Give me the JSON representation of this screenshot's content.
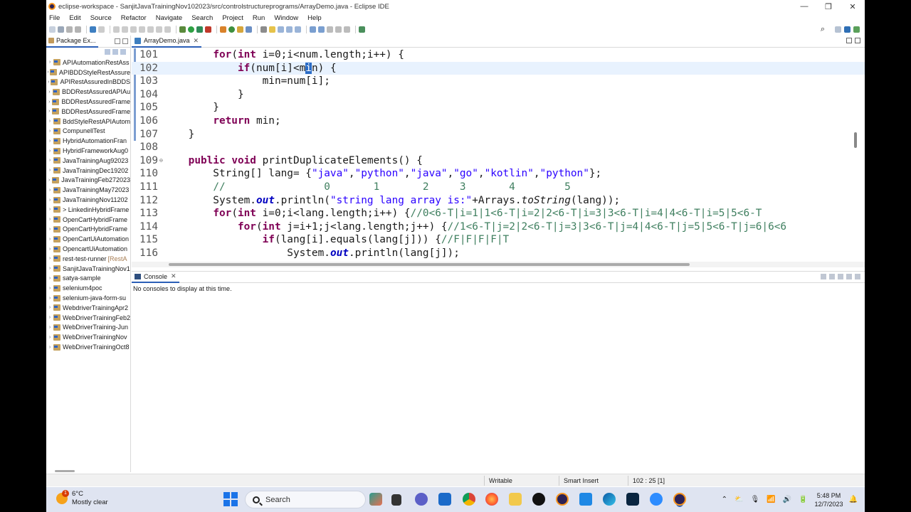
{
  "window": {
    "title": "eclipse-workspace - SanjitJavaTrainingNov102023/src/controlstructureprograms/ArrayDemo.java - Eclipse IDE"
  },
  "menu": [
    "File",
    "Edit",
    "Source",
    "Refactor",
    "Navigate",
    "Search",
    "Project",
    "Run",
    "Window",
    "Help"
  ],
  "package_explorer": {
    "tab_label": "Package Ex...",
    "projects": [
      {
        "name": "APIAutomationRestAss",
        "badge": ""
      },
      {
        "name": "APIBDDStyleRestAssure",
        "badge": ""
      },
      {
        "name": "APIRestAssuredInBDDS",
        "badge": ""
      },
      {
        "name": "BDDRestAssuredAPIAu",
        "badge": ""
      },
      {
        "name": "BDDRestAssuredFrame",
        "badge": ""
      },
      {
        "name": "BDDRestAssuredFrame",
        "badge": ""
      },
      {
        "name": "BddStyleRestAPIAutom",
        "badge": ""
      },
      {
        "name": "CompunellTest",
        "badge": ""
      },
      {
        "name": "HybridAutomationFran",
        "badge": ""
      },
      {
        "name": "HybridFrameworkAug0",
        "badge": ""
      },
      {
        "name": "JavaTrainingAug92023",
        "badge": ""
      },
      {
        "name": "JavaTrainingDec19202",
        "badge": ""
      },
      {
        "name": "JavaTrainingFeb272023",
        "badge": ""
      },
      {
        "name": "JavaTrainingMay72023",
        "badge": ""
      },
      {
        "name": "JavaTrainingNov11202",
        "badge": ""
      },
      {
        "name": "> LinkedinHybridFrame",
        "badge": ""
      },
      {
        "name": "OpenCartHybridFrame",
        "badge": ""
      },
      {
        "name": "OpenCartHybridFrame",
        "badge": ""
      },
      {
        "name": "OpenCartUiAutomation",
        "badge": ""
      },
      {
        "name": "OpencartUiAutomation",
        "badge": ""
      },
      {
        "name": "rest-test-runner",
        "badge": "[RestA"
      },
      {
        "name": "SanjitJavaTrainingNov1",
        "badge": ""
      },
      {
        "name": "satya-sample",
        "badge": ""
      },
      {
        "name": "selenium4poc",
        "badge": ""
      },
      {
        "name": "selenium-java-form-su",
        "badge": ""
      },
      {
        "name": "WebdriverTrainingApr2",
        "badge": ""
      },
      {
        "name": "WebDriverTrainingFeb2",
        "badge": ""
      },
      {
        "name": "WebDriverTraining-Jun",
        "badge": ""
      },
      {
        "name": "WebDriverTrainingNov",
        "badge": ""
      },
      {
        "name": "WebDriverTrainingOct8",
        "badge": ""
      }
    ]
  },
  "editor": {
    "tab_label": "ArrayDemo.java",
    "current_line": 102,
    "lines": [
      {
        "n": "101",
        "fold": "",
        "html": "        <span class='kw'>for</span>(<span class='kw'>int</span> i=0;i&lt;num.length;i++) {"
      },
      {
        "n": "102",
        "fold": "",
        "html": "            <span class='kw'>if</span>(num[i]&lt;m<span class='sel'>i</span>n) {"
      },
      {
        "n": "103",
        "fold": "",
        "html": "                min=num[i];"
      },
      {
        "n": "104",
        "fold": "",
        "html": "            }"
      },
      {
        "n": "105",
        "fold": "",
        "html": "        }"
      },
      {
        "n": "106",
        "fold": "",
        "html": "        <span class='kw'>return</span> min;"
      },
      {
        "n": "107",
        "fold": "",
        "html": "    }"
      },
      {
        "n": "108",
        "fold": "",
        "html": ""
      },
      {
        "n": "109",
        "fold": "⊖",
        "html": "    <span class='kw'>public</span> <span class='kw'>void</span> printDuplicateElements() {"
      },
      {
        "n": "110",
        "fold": "",
        "html": "        String[] lang= {<span class='str'>\"java\"</span>,<span class='str'>\"python\"</span>,<span class='str'>\"java\"</span>,<span class='str'>\"go\"</span>,<span class='str'>\"kotlin\"</span>,<span class='str'>\"python\"</span>};"
      },
      {
        "n": "111",
        "fold": "",
        "html": "        <span class='cm'>//                0       1       2     3       4        5</span>"
      },
      {
        "n": "112",
        "fold": "",
        "html": "        System.<span class='fld'>out</span>.println(<span class='str'>\"string lang array is:\"</span>+Arrays.<i>toString</i>(lang));"
      },
      {
        "n": "113",
        "fold": "",
        "html": "        <span class='kw'>for</span>(<span class='kw'>int</span> i=0;i&lt;lang.length;i++) {<span class='cm'>//0&lt;6-T|i=1|1&lt;6-T|i=2|2&lt;6-T|i=3|3&lt;6-T|i=4|4&lt;6-T|i=5|5&lt;6-T</span>"
      },
      {
        "n": "114",
        "fold": "",
        "html": "            <span class='kw'>for</span>(<span class='kw'>int</span> j=i+1;j&lt;lang.length;j++) {<span class='cm'>//1&lt;6-T|j=2|2&lt;6-T|j=3|3&lt;6-T|j=4|4&lt;6-T|j=5|5&lt;6-T|j=6|6&lt;6</span>"
      },
      {
        "n": "115",
        "fold": "",
        "html": "                <span class='kw'>if</span>(lang[i].equals(lang[j])) {<span class='cm'>//F|F|F|F|T</span>"
      },
      {
        "n": "116",
        "fold": "",
        "html": "                    System.<span class='fld'>out</span>.println(lang[j]);"
      }
    ]
  },
  "console": {
    "tab_label": "Console",
    "message": "No consoles to display at this time."
  },
  "statusbar": {
    "mode": "Writable",
    "insert": "Smart Insert",
    "position": "102 : 25 [1]"
  },
  "taskbar": {
    "weather_temp": "6°C",
    "weather_desc": "Mostly clear",
    "weather_badge": "1",
    "search_label": "Search",
    "time": "5:48 PM",
    "date": "12/7/2023"
  }
}
